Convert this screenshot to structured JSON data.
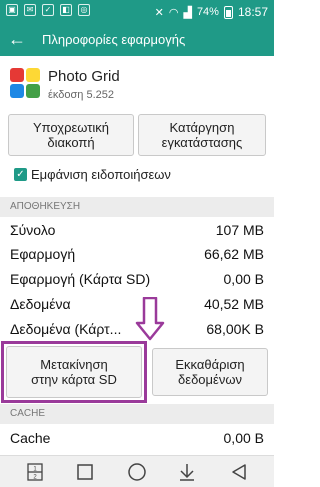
{
  "status_bar": {
    "icons": [
      "photo-icon",
      "mail-icon",
      "checkmark-icon",
      "app-icon",
      "lg-icon"
    ],
    "right_icons": [
      "mute-icon",
      "wifi-icon",
      "signal-icon"
    ],
    "battery": "74%",
    "time": "18:57"
  },
  "app_bar": {
    "title": "Πληροφορίες εφαρμογής"
  },
  "app": {
    "name": "Photo Grid",
    "version": "έκδοση 5.252",
    "icon_colors": [
      "#e53935",
      "#fdd835",
      "#1e88e5",
      "#43a047"
    ]
  },
  "buttons": {
    "force_stop": "Υποχρεωτική\nδιακοπή",
    "uninstall": "Κατάργηση\nεγκατάστασης",
    "move_to_sd": "Μετακίνηση\nστην κάρτα SD",
    "clear_data": "Εκκαθάριση\nδεδομένων"
  },
  "notifications": {
    "label": "Εμφάνιση ειδοποιήσεων",
    "checked": true
  },
  "storage": {
    "header": "ΑΠΟΘΗΚΕΥΣΗ",
    "rows": [
      {
        "label": "Σύνολο",
        "value": "107 MB"
      },
      {
        "label": "Εφαρμογή",
        "value": "66,62 MB"
      },
      {
        "label": "Εφαρμογή (Κάρτα SD)",
        "value": "0,00 B"
      },
      {
        "label": "Δεδομένα",
        "value": "40,52 MB"
      },
      {
        "label": "Δεδομένα (Κάρτ...",
        "value": "68,00K B"
      }
    ]
  },
  "cache": {
    "header": "CACHE",
    "rows": [
      {
        "label": "Cache",
        "value": "0,00 B"
      }
    ]
  },
  "nav_bar": {
    "dual_window_label": "1\n2"
  },
  "colors": {
    "accent": "#1f9a87",
    "highlight": "#9a3a9a"
  }
}
